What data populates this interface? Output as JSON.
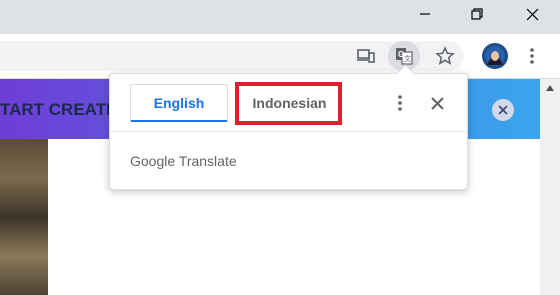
{
  "translate_bubble": {
    "source_language": "English",
    "target_language": "Indonesian",
    "brand": "Google Translate"
  },
  "page": {
    "banner_text": "TART CREATI"
  },
  "colors": {
    "accent_blue": "#1a73e8",
    "highlight_red": "#e0202e",
    "banner_start": "#6f3dd8",
    "banner_end": "#3aa5ec"
  }
}
